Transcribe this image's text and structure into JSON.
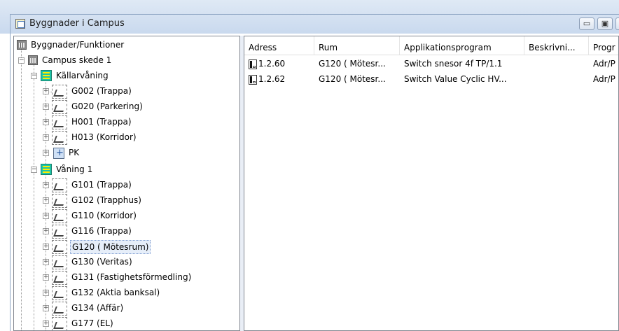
{
  "window": {
    "title": "Byggnader i Campus",
    "buttons": {
      "minimize": "▭",
      "maximize": "▣",
      "close": "✕"
    }
  },
  "tree": {
    "root": "Byggnader/Funktioner",
    "building": "Campus skede 1",
    "floors": [
      {
        "label": "Källarvåning",
        "rooms": [
          {
            "label": "G002 (Trappa)"
          },
          {
            "label": "G020 (Parkering)"
          },
          {
            "label": "H001 (Trappa)"
          },
          {
            "label": "H013 (Korridor)"
          },
          {
            "label": "PK"
          }
        ]
      },
      {
        "label": "Våning 1",
        "rooms": [
          {
            "label": "G101 (Trappa)"
          },
          {
            "label": "G102 (Trapphus)"
          },
          {
            "label": "G110 (Korridor)"
          },
          {
            "label": "G116 (Trappa)"
          },
          {
            "label": "G120 ( Mötesrum)"
          },
          {
            "label": "G130 (Veritas)"
          },
          {
            "label": "G131 (Fastighetsförmedling)"
          },
          {
            "label": "G132 (Aktia banksal)"
          },
          {
            "label": "G134 (Affär)"
          },
          {
            "label": "G177 (EL)"
          }
        ]
      }
    ],
    "selected_room": "G120 ( Mötesrum)"
  },
  "list": {
    "columns": [
      "Adress",
      "Rum",
      "Applikationsprogram",
      "Beskrivni...",
      "Progr"
    ],
    "rows": [
      [
        "1.2.60",
        "G120 ( Mötesr...",
        "Switch snesor 4f TP/1.1",
        "",
        "Adr/P"
      ],
      [
        "1.2.62",
        "G120 ( Mötesr...",
        "Switch Value Cyclic HV...",
        "",
        "Adr/P"
      ]
    ]
  }
}
